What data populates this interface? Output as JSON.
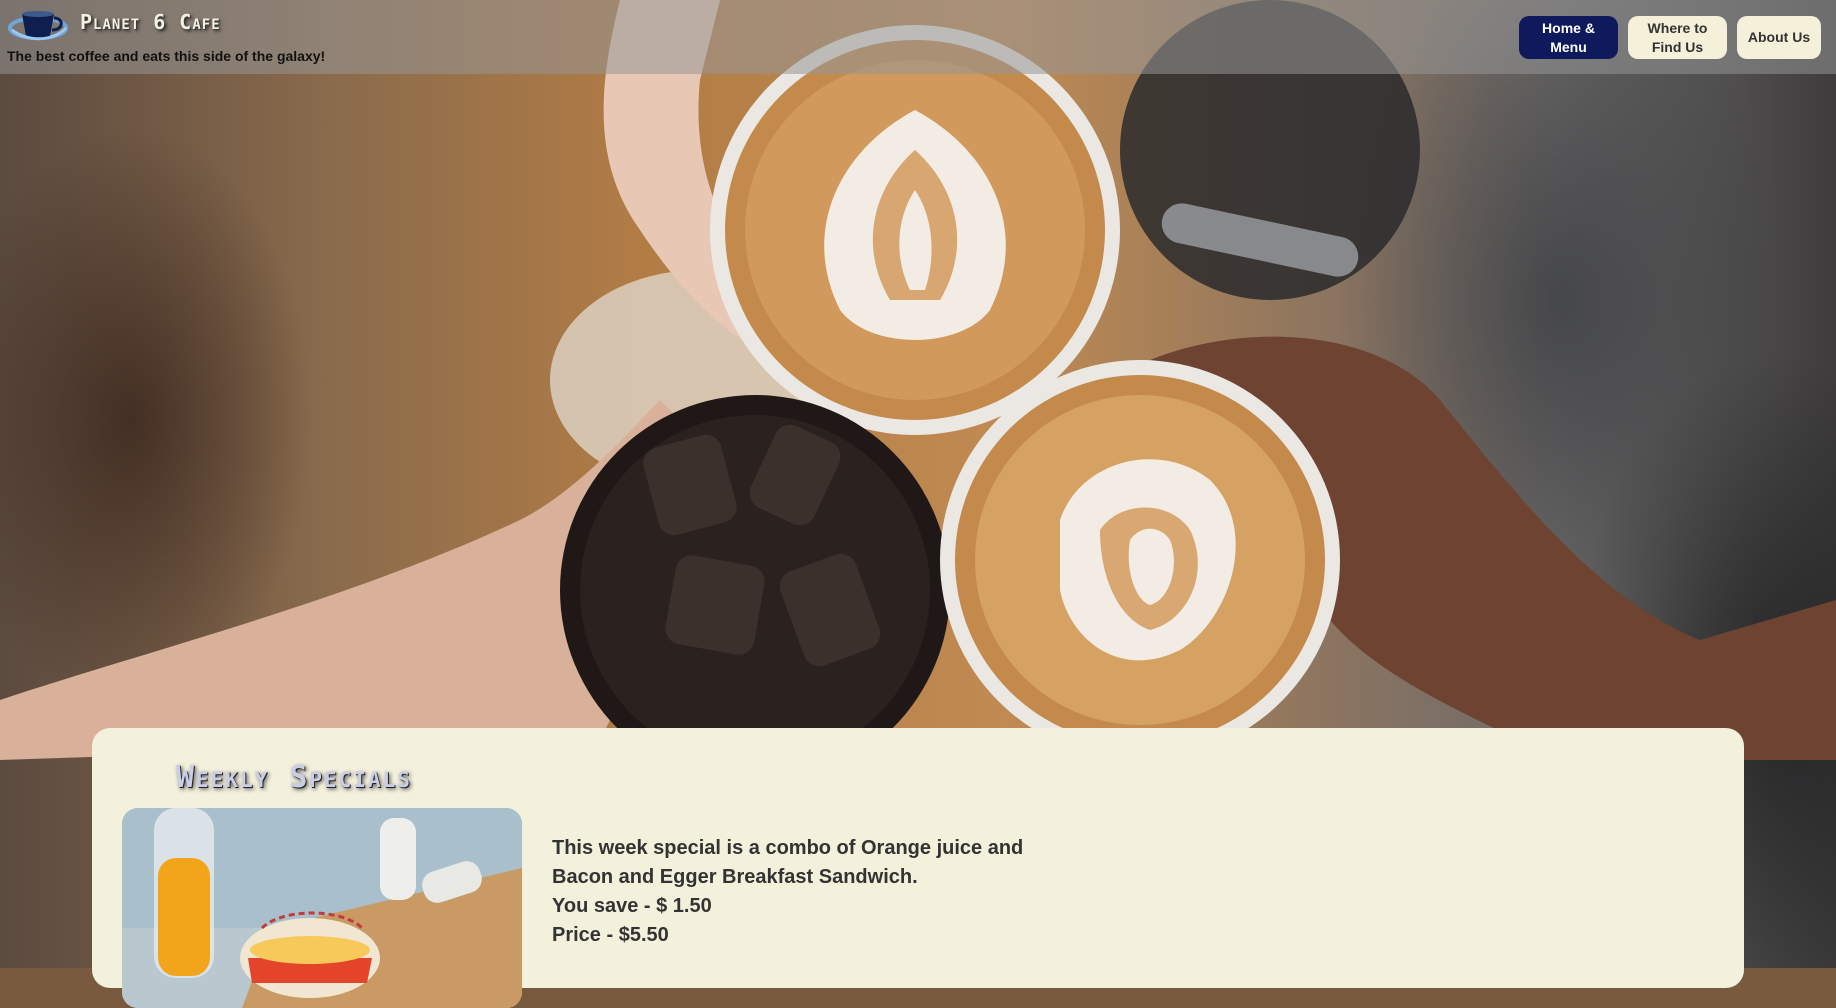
{
  "header": {
    "brand": "Planet 6 Cafe",
    "tagline": "The best coffee and eats this side of the galaxy!",
    "logo_icon": "planet-coffee-cup-icon"
  },
  "nav": {
    "items": [
      {
        "label": "Home & Menu",
        "active": true
      },
      {
        "label": "Where to Find Us",
        "active": false
      },
      {
        "label": "About Us",
        "active": false
      }
    ]
  },
  "hero": {
    "image": "three-coffee-cups-toast"
  },
  "specials": {
    "title": "Weekly Specials",
    "image": "orange-juice-breakfast-sandwich",
    "description": "This week special is a combo of Orange juice and Bacon and Egger Breakfast Sandwich.",
    "savings": "You save - $ 1.50",
    "price": "Price - $5.50"
  },
  "colors": {
    "nav_active_bg": "#0f1a5c",
    "nav_idle_bg": "#f4f0da",
    "card_bg": "#f3f0dc",
    "header_bg": "rgba(150,150,150,0.55)"
  }
}
